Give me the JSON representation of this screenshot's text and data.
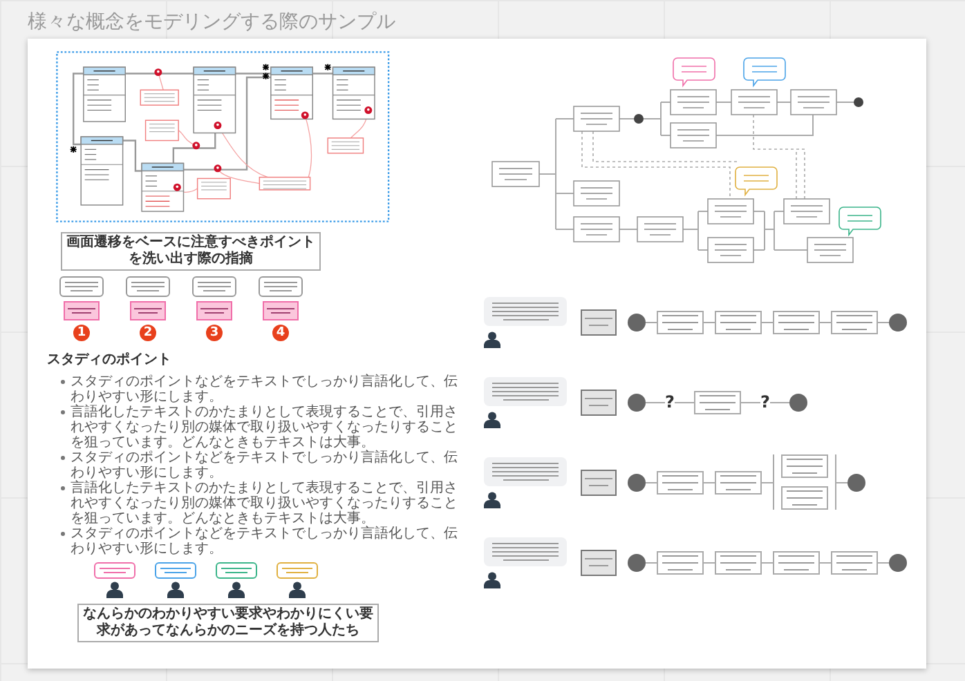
{
  "title": "様々な概念をモデリングする際のサンプル",
  "review": {
    "heading": "画面遷移をベースに注意すべきポイントを洗い出す際の指摘",
    "steps": [
      {
        "number": "1"
      },
      {
        "number": "2"
      },
      {
        "number": "3"
      },
      {
        "number": "4"
      }
    ]
  },
  "study": {
    "heading": "スタディのポイント",
    "bullets": [
      "スタディのポイントなどをテキストでしっかり言語化して、伝わりやすい形にします。",
      "言語化したテキストのかたまりとして表現することで、引用されやすくなったり別の媒体で取り扱いやすくなったりすることを狙っています。どんなときもテキストは大事。",
      "スタディのポイントなどをテキストでしっかり言語化して、伝わりやすい形にします。",
      "言語化したテキストのかたまりとして表現することで、引用されやすくなったり別の媒体で取り扱いやすくなったりすることを狙っています。どんなときもテキストは大事。",
      "スタディのポイントなどをテキストでしっかり言語化して、伝わりやすい形にします。"
    ]
  },
  "people": {
    "bubbles": [
      {
        "color": "#f06ea9"
      },
      {
        "color": "#4aa3e8"
      },
      {
        "color": "#3bb58a"
      },
      {
        "color": "#e0b040"
      }
    ],
    "caption": "なんらかのわかりやすい要求やわかりにくい要求があってなんらかのニーズを持つ人たち"
  },
  "flows": [
    {
      "steps": [
        {
          "kind": "start"
        },
        {
          "kind": "task"
        },
        {
          "kind": "task"
        },
        {
          "kind": "task"
        },
        {
          "kind": "task"
        },
        {
          "kind": "done"
        }
      ]
    },
    {
      "steps": [
        {
          "kind": "start"
        },
        {
          "kind": "unknown",
          "label": "?"
        },
        {
          "kind": "task"
        },
        {
          "kind": "unknown",
          "label": "?"
        },
        {
          "kind": "done"
        }
      ]
    },
    {
      "steps": [
        {
          "kind": "start"
        },
        {
          "kind": "task"
        },
        {
          "kind": "task"
        },
        {
          "kind": "branch"
        },
        {
          "kind": "done"
        }
      ]
    },
    {
      "steps": [
        {
          "kind": "start"
        },
        {
          "kind": "task"
        },
        {
          "kind": "task"
        },
        {
          "kind": "task"
        },
        {
          "kind": "task"
        },
        {
          "kind": "done"
        }
      ]
    }
  ]
}
